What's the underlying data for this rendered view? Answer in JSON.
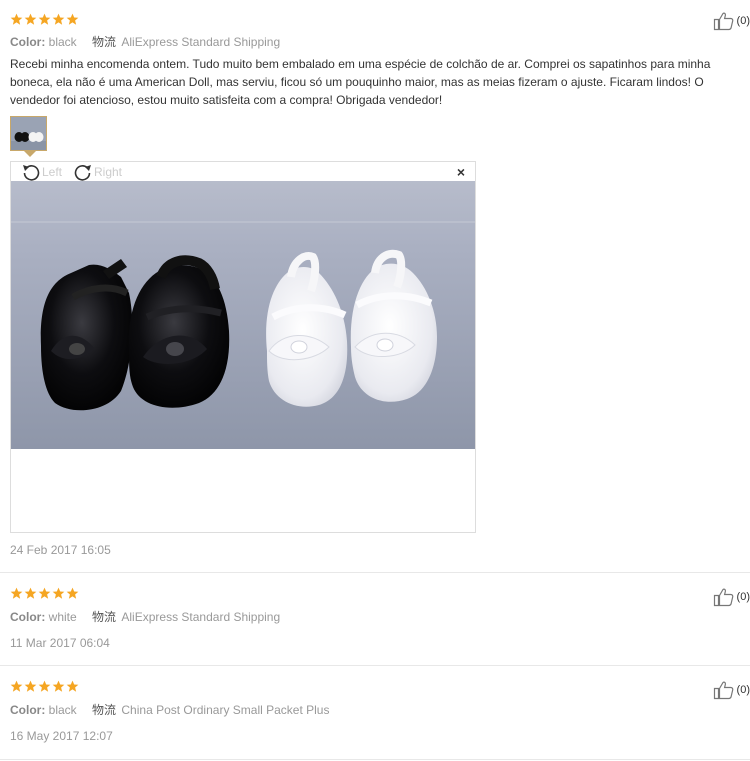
{
  "colors": {
    "star": "#f5a623",
    "label_gray": "#999999",
    "text": "#333333"
  },
  "reviews": [
    {
      "stars": 5,
      "color_label": "Color:",
      "color_value": "black",
      "logistics_label": "物流",
      "shipping": "AliExpress Standard Shipping",
      "helpful_icon": "thumbs-up-icon",
      "helpful_count": "(0)",
      "content": "Recebi minha encomenda ontem. Tudo muito bem embalado em uma espécie de colchão de ar. Comprei os sapatinhos para minha boneca, ela não é uma American Doll, mas serviu, ficou só um pouquinho maior, mas as meias fizeram o ajuste. Ficaram lindos! O vendedor foi atencioso, estou muito satisfeita com a compra! Obrigada vendedor!",
      "date": "24 Feb 2017 16:05"
    },
    {
      "stars": 5,
      "color_label": "Color:",
      "color_value": "white",
      "logistics_label": "物流",
      "shipping": "AliExpress Standard Shipping",
      "helpful_icon": "thumbs-up-icon",
      "helpful_count": "(0)",
      "date": "11 Mar 2017 06:04"
    },
    {
      "stars": 5,
      "color_label": "Color:",
      "color_value": "black",
      "logistics_label": "物流",
      "shipping": "China Post Ordinary Small Packet Plus",
      "helpful_icon": "thumbs-up-icon",
      "helpful_count": "(0)",
      "date": "16 May 2017 12:07"
    }
  ],
  "viewer": {
    "rotate_left_label": "Left",
    "rotate_right_label": "Right",
    "close_label": "×",
    "rotate_left_icon": "rotate-left-icon",
    "rotate_right_icon": "rotate-right-icon"
  }
}
